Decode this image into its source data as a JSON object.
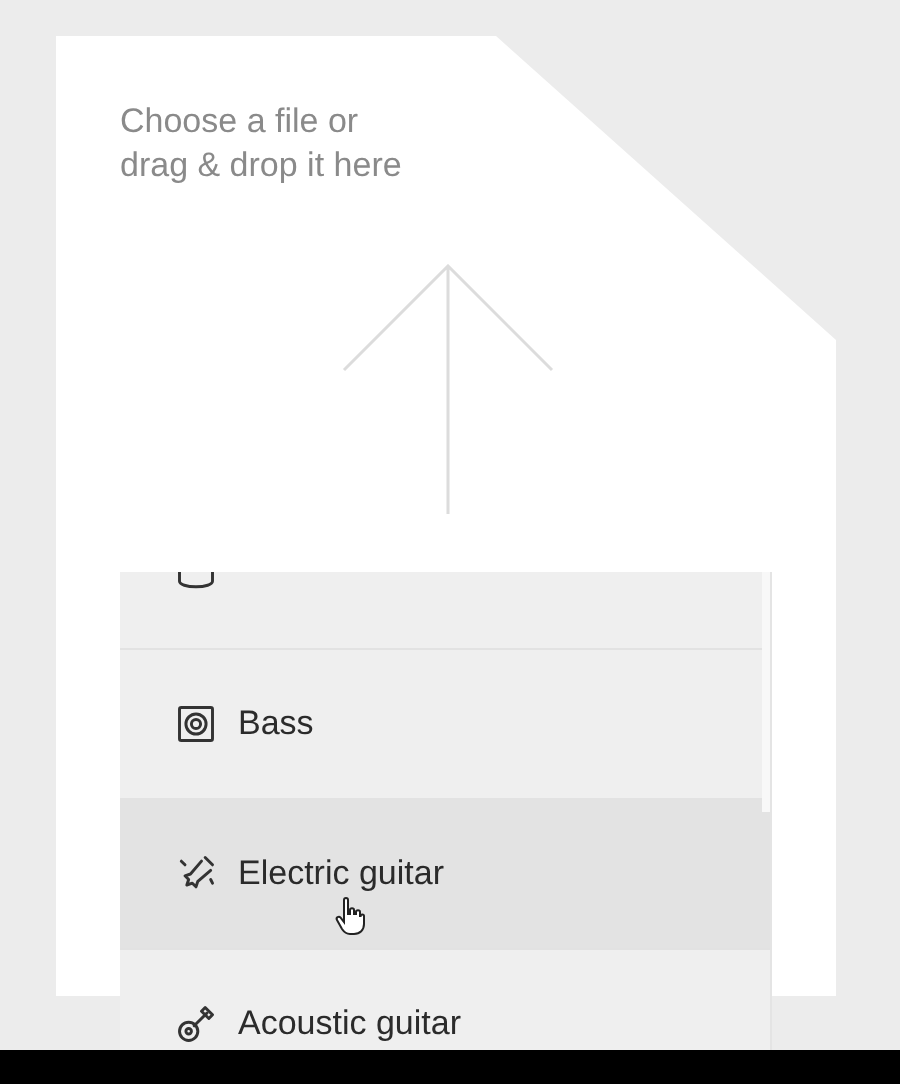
{
  "upload": {
    "prompt_lines": [
      "Choose a file or",
      "drag & drop it here"
    ]
  },
  "dropdown": {
    "items": [
      {
        "kind": "drums",
        "selected": false
      },
      {
        "kind": "bass",
        "label": "Bass",
        "selected": false
      },
      {
        "kind": "electric",
        "label": "Electric guitar",
        "selected": true
      },
      {
        "kind": "acoustic",
        "label": "Acoustic guitar",
        "selected": false
      }
    ]
  }
}
